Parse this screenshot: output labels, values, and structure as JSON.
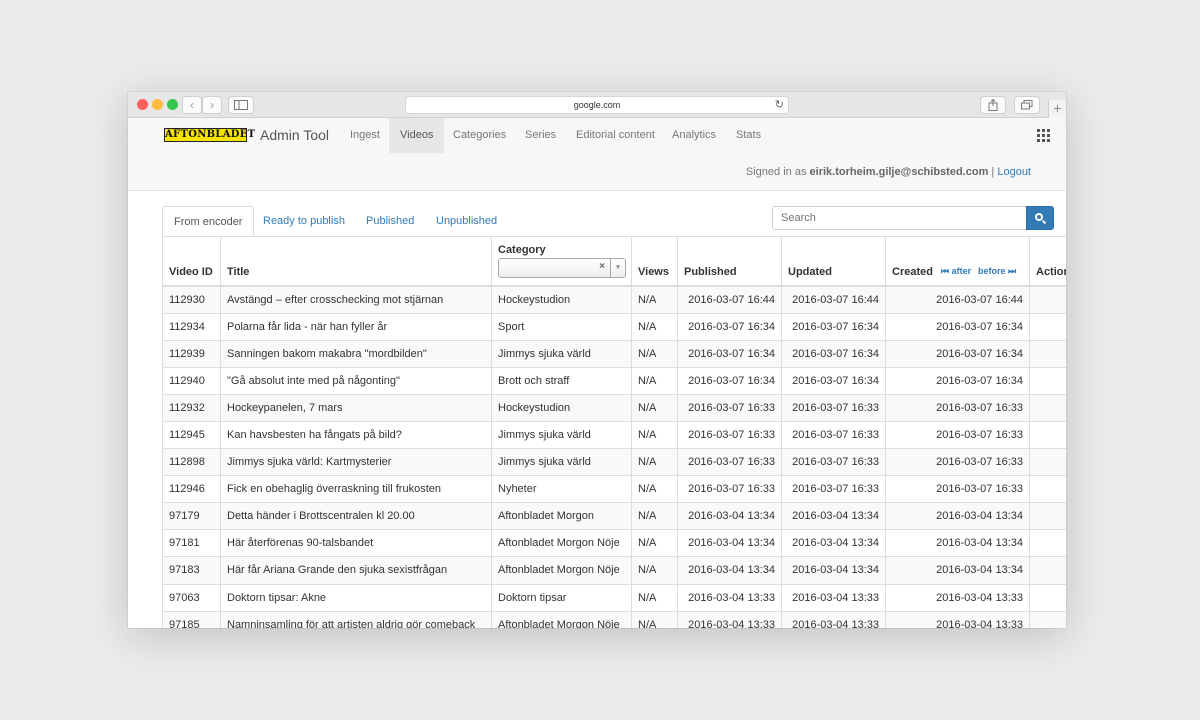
{
  "browser": {
    "url": "google.com",
    "reload_icon": "↻",
    "back_icon": "‹",
    "forward_icon": "›",
    "new_tab_icon": "+"
  },
  "header": {
    "logo_text": "AFTONBLADET",
    "brand": "Admin Tool",
    "nav": [
      "Ingest",
      "Videos",
      "Categories",
      "Series",
      "Editorial content",
      "Analytics",
      "Stats"
    ],
    "active_nav": "Videos",
    "signed_in_prefix": "Signed in as",
    "user_email": "eirik.torheim.gilje@schibsted.com",
    "separator": "|",
    "logout": "Logout"
  },
  "tabs": [
    "From encoder",
    "Ready to publish",
    "Published",
    "Unpublished"
  ],
  "active_tab": "From encoder",
  "search": {
    "placeholder": "Search"
  },
  "table": {
    "headers": {
      "video_id": "Video ID",
      "title": "Title",
      "category": "Category",
      "views": "Views",
      "published": "Published",
      "updated": "Updated",
      "created": "Created",
      "actions": "Actions"
    },
    "category_filter_clear": "×",
    "category_filter_arrow": "▾",
    "pager_after": "after",
    "pager_before": "before",
    "rows": [
      [
        "112930",
        "Avstängd – efter crosschecking mot stjärnan",
        "Hockeystudion",
        "N/A",
        "2016-03-07 16:44",
        "2016-03-07 16:44",
        "2016-03-07 16:44"
      ],
      [
        "112934",
        "Polarna får lida - när han fyller år",
        "Sport",
        "N/A",
        "2016-03-07 16:34",
        "2016-03-07 16:34",
        "2016-03-07 16:34"
      ],
      [
        "112939",
        "Sanningen bakom makabra \"mordbilden\"",
        "Jimmys sjuka värld",
        "N/A",
        "2016-03-07 16:34",
        "2016-03-07 16:34",
        "2016-03-07 16:34"
      ],
      [
        "112940",
        "\"Gå absolut inte med på någonting\"",
        "Brott och straff",
        "N/A",
        "2016-03-07 16:34",
        "2016-03-07 16:34",
        "2016-03-07 16:34"
      ],
      [
        "112932",
        "Hockeypanelen, 7 mars",
        "Hockeystudion",
        "N/A",
        "2016-03-07 16:33",
        "2016-03-07 16:33",
        "2016-03-07 16:33"
      ],
      [
        "112945",
        "Kan havsbesten ha fångats på bild?",
        "Jimmys sjuka värld",
        "N/A",
        "2016-03-07 16:33",
        "2016-03-07 16:33",
        "2016-03-07 16:33"
      ],
      [
        "112898",
        "Jimmys sjuka värld: Kartmysterier",
        "Jimmys sjuka värld",
        "N/A",
        "2016-03-07 16:33",
        "2016-03-07 16:33",
        "2016-03-07 16:33"
      ],
      [
        "112946",
        "Fick en obehaglig överraskning till frukosten",
        "Nyheter",
        "N/A",
        "2016-03-07 16:33",
        "2016-03-07 16:33",
        "2016-03-07 16:33"
      ],
      [
        "97179",
        "Detta händer i Brottscentralen kl 20.00",
        "Aftonbladet Morgon",
        "N/A",
        "2016-03-04 13:34",
        "2016-03-04 13:34",
        "2016-03-04 13:34"
      ],
      [
        "97181",
        "Här återförenas 90-talsbandet",
        "Aftonbladet Morgon Nöje",
        "N/A",
        "2016-03-04 13:34",
        "2016-03-04 13:34",
        "2016-03-04 13:34"
      ],
      [
        "97183",
        "Här får Ariana Grande den sjuka sexistfrågan",
        "Aftonbladet Morgon Nöje",
        "N/A",
        "2016-03-04 13:34",
        "2016-03-04 13:34",
        "2016-03-04 13:34"
      ],
      [
        "97063",
        "Doktorn tipsar: Akne",
        "Doktorn tipsar",
        "N/A",
        "2016-03-04 13:33",
        "2016-03-04 13:33",
        "2016-03-04 13:33"
      ],
      [
        "97185",
        "Namninsamling för att artisten aldrig gör comeback",
        "Aftonbladet Morgon Nöje",
        "N/A",
        "2016-03-04 13:33",
        "2016-03-04 13:33",
        "2016-03-04 13:33"
      ]
    ]
  }
}
